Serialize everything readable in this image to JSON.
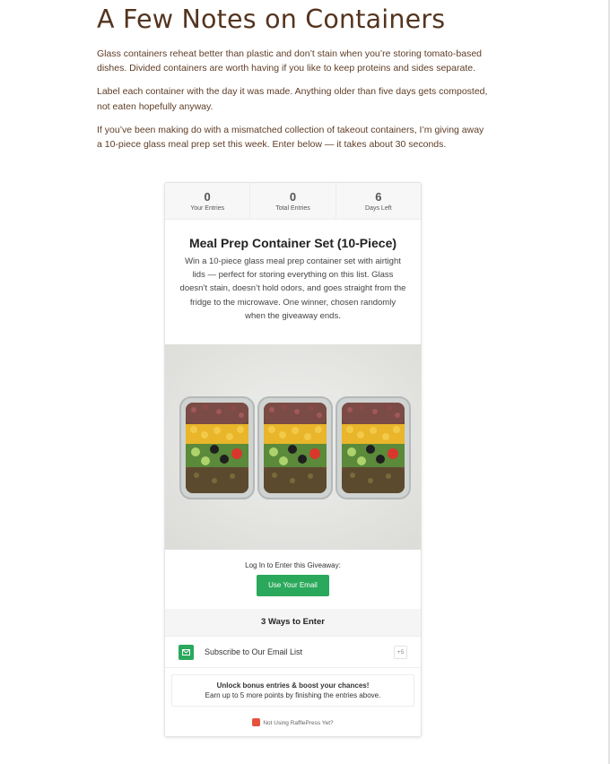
{
  "article": {
    "title": "A Few Notes on Containers",
    "paragraphs": [
      "Glass containers reheat better than plastic and don’t stain when you’re storing tomato-based dishes. Divided containers are worth having if you like to keep proteins and sides separate.",
      "Label each container with the day it was made. Anything older than five days gets composted, not eaten hopefully anyway.",
      "If you’ve been making do with a mismatched collection of takeout containers, I’m giving away a 10-piece glass meal prep set this week. Enter below — it takes about 30 seconds."
    ]
  },
  "giveaway": {
    "stats": [
      {
        "value": "0",
        "label": "Your Entries"
      },
      {
        "value": "0",
        "label": "Total Entries"
      },
      {
        "value": "6",
        "label": "Days Left"
      }
    ],
    "prize_title": "Meal Prep Container Set (10-Piece)",
    "prize_description": "Win a 10-piece glass meal prep container set with airtight lids — perfect for storing everything on this list. Glass doesn’t stain, doesn’t hold odors, and goes straight from the fridge to the microwave. One winner, chosen randomly when the giveaway ends.",
    "login_label": "Log In to Enter this Giveaway:",
    "login_button": "Use Your Email",
    "ways_heading": "3 Ways to Enter",
    "entries": [
      {
        "label": "Subscribe to Our Email List",
        "points": "+5",
        "icon": "mail-icon"
      }
    ],
    "bonus_title": "Unlock bonus entries & boost your chances!",
    "bonus_text": "Earn up to 5 more points by finishing the entries above.",
    "footer_text": "Not Using RafflePress Yet?"
  },
  "colors": {
    "title_brown": "#54341f",
    "body_brown": "#5e3d26",
    "accent_green": "#2aa85b"
  }
}
